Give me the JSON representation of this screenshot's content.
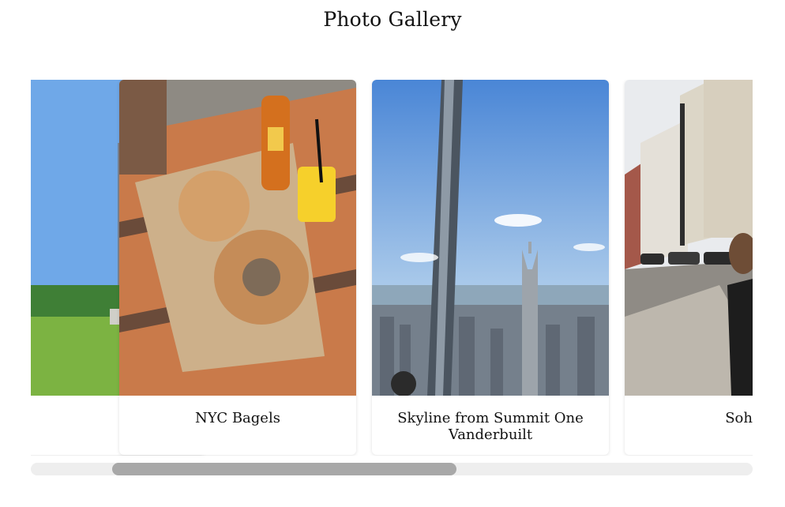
{
  "gallery": {
    "title": "Photo Gallery",
    "cards": [
      {
        "caption": "",
        "photo": "park-photo"
      },
      {
        "caption": "NYC Bagels",
        "photo": "bagels-photo"
      },
      {
        "caption": "Skyline from Summit One Vanderbuilt",
        "photo": "skyline-photo"
      },
      {
        "caption": "Soho",
        "photo": "street-photo"
      }
    ]
  },
  "colors": {
    "scroll_track": "#eeeeee",
    "scroll_thumb": "#a8a8a8"
  }
}
